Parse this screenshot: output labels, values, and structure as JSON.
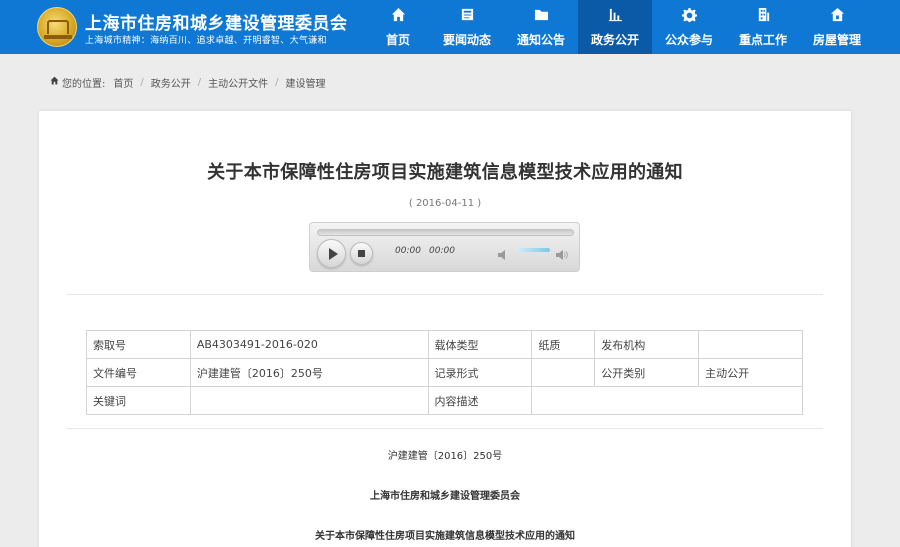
{
  "header": {
    "site_title": "上海市住房和城乡建设管理委员会",
    "motto": "上海城市精神：海纳百川、追求卓越、开明睿智、大气谦和",
    "nav": [
      {
        "label": "首页",
        "icon": "home-icon"
      },
      {
        "label": "要闻动态",
        "icon": "news-icon"
      },
      {
        "label": "通知公告",
        "icon": "folder-icon"
      },
      {
        "label": "政务公开",
        "icon": "chart-icon",
        "active": true
      },
      {
        "label": "公众参与",
        "icon": "gear-icon"
      },
      {
        "label": "重点工作",
        "icon": "building-icon"
      },
      {
        "label": "房屋管理",
        "icon": "house-icon"
      }
    ]
  },
  "breadcrumb": {
    "prefix": "您的位置:",
    "items": [
      "首页",
      "政务公开",
      "主动公开文件",
      "建设管理"
    ]
  },
  "article": {
    "title": "关于本市保障性住房项目实施建筑信息模型技术应用的通知",
    "date": "( 2016-04-11 )",
    "player": {
      "current_time": "00:00",
      "duration": "00:00"
    }
  },
  "info_table": {
    "rows": [
      [
        "索取号",
        "AB4303491-2016-020",
        "载体类型",
        "纸质",
        "发布机构",
        ""
      ],
      [
        "文件编号",
        "沪建建管〔2016〕250号",
        "记录形式",
        "",
        "公开类别",
        "主动公开"
      ],
      [
        "关键词",
        "",
        "内容描述",
        "",
        "",
        ""
      ]
    ]
  },
  "body": {
    "doc_number": "沪建建管〔2016〕250号",
    "issuer": "上海市住房和城乡建设管理委员会",
    "subject": "关于本市保障性住房项目实施建筑信息模型技术应用的通知"
  }
}
